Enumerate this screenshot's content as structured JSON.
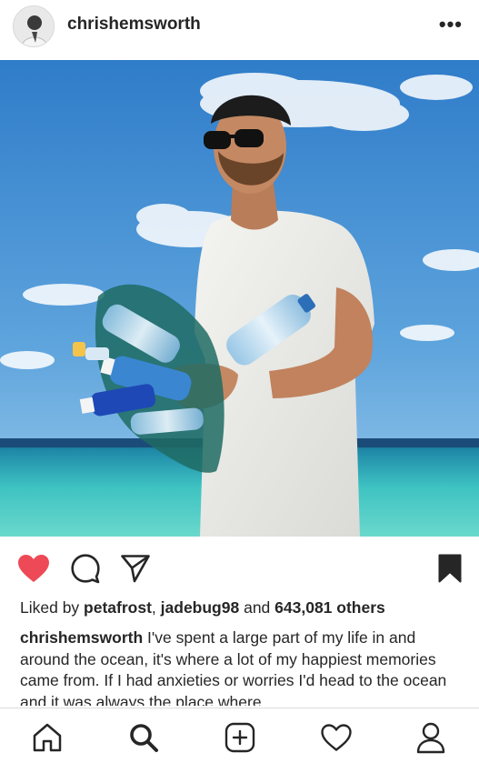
{
  "post": {
    "username": "chrishemsworth",
    "more_icon": "more-horizontal-icon"
  },
  "actions": {
    "like_icon": "heart-filled-icon",
    "comment_icon": "comment-icon",
    "share_icon": "paper-plane-icon",
    "save_icon": "bookmark-filled-icon",
    "like_color": "#ed4956"
  },
  "likes": {
    "prefix": "Liked by ",
    "user1": "petafrost",
    "sep": ", ",
    "user2": "jadebug98",
    "and": " and ",
    "count": "643,081 others"
  },
  "caption": {
    "author": "chrishemsworth",
    "text": " I've spent a large part of my life in and around the ocean, it's where a lot of my happiest memories came from. If I had anxieties or worries I'd head to the ocean and it was always the place where"
  },
  "tabbar": {
    "items": [
      "home-icon",
      "search-icon",
      "new-post-icon",
      "activity-heart-icon",
      "profile-icon"
    ]
  }
}
